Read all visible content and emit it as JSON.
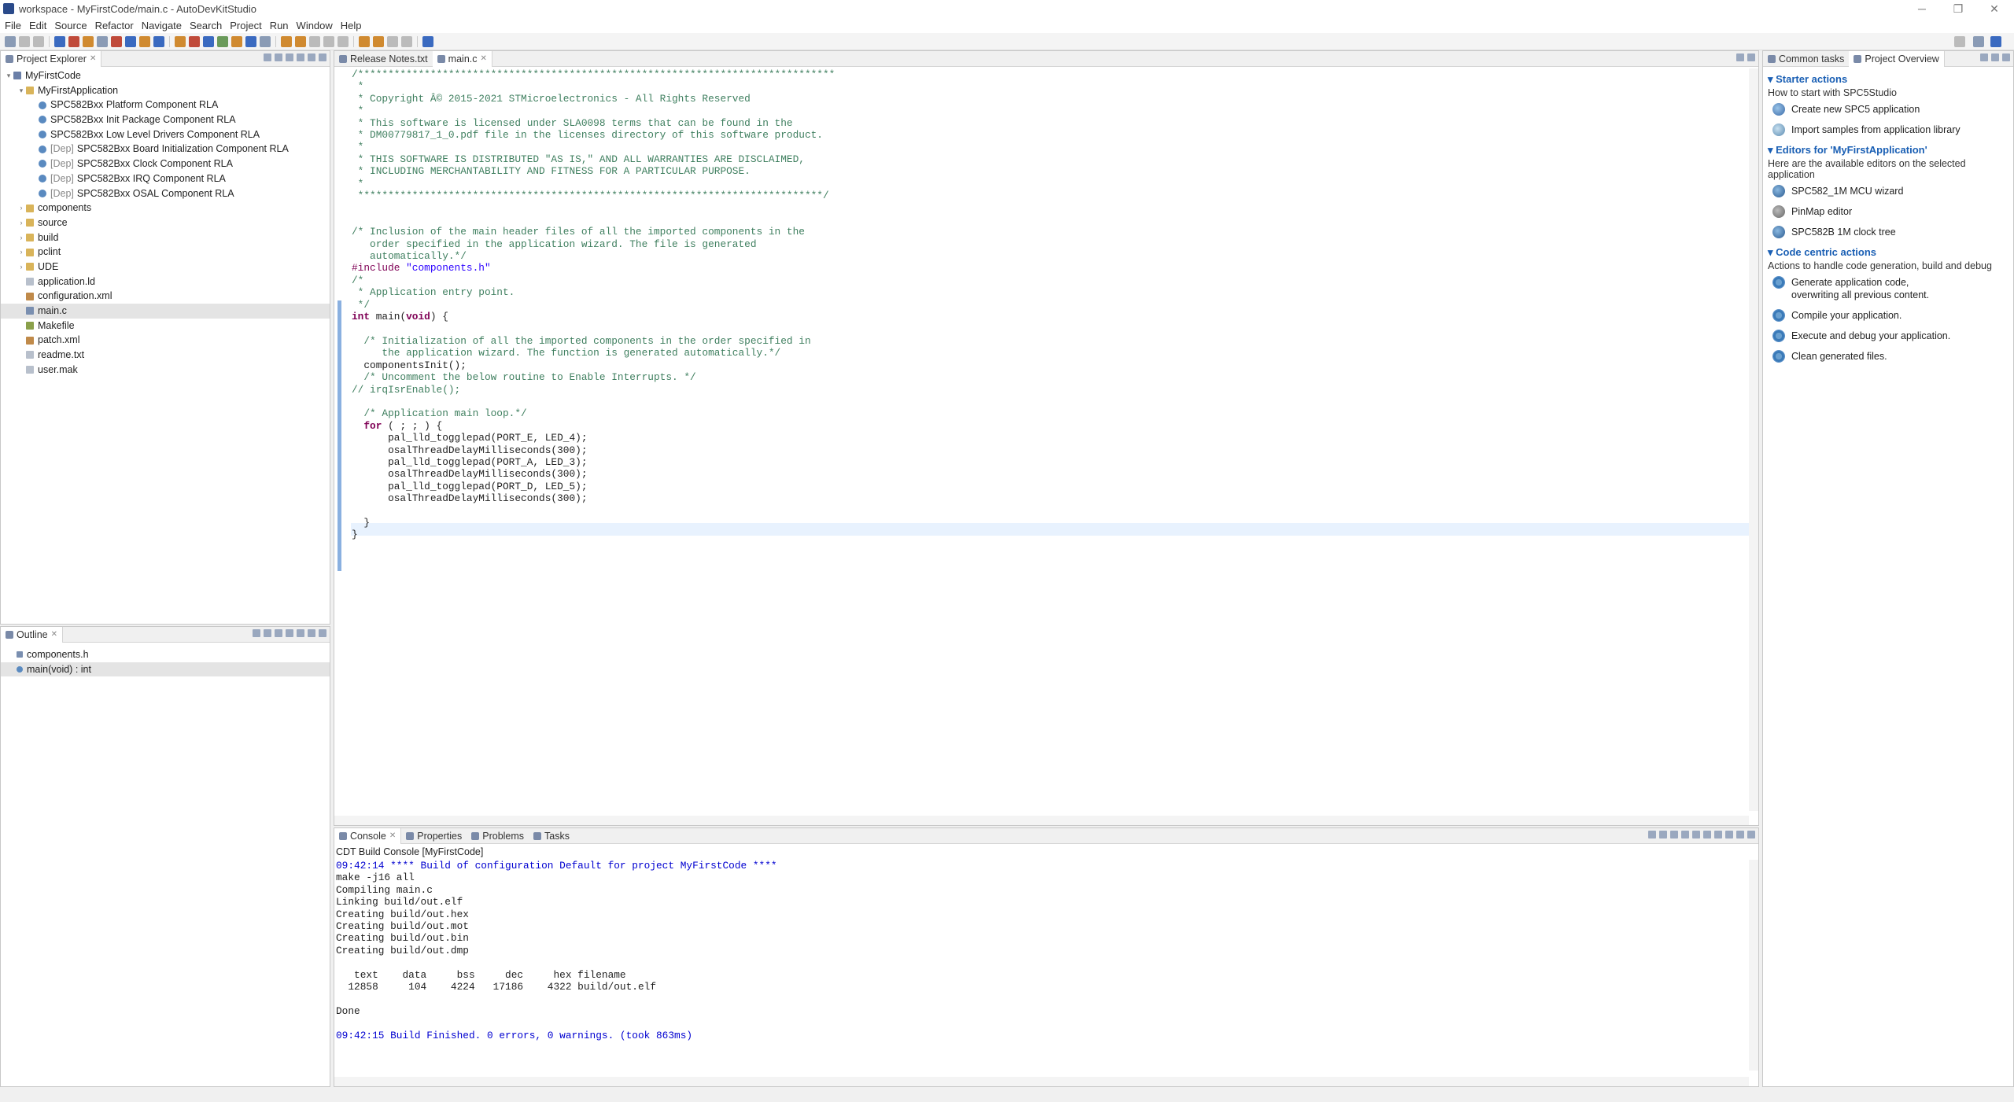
{
  "window": {
    "title": "workspace - MyFirstCode/main.c - AutoDevKitStudio",
    "controls": [
      "─",
      "❐",
      "✕"
    ]
  },
  "menu": [
    "File",
    "Edit",
    "Source",
    "Refactor",
    "Navigate",
    "Search",
    "Project",
    "Run",
    "Window",
    "Help"
  ],
  "project_explorer": {
    "title": "Project Explorer",
    "tree": [
      {
        "label": "MyFirstCode",
        "depth": 0,
        "icon": "project-icon",
        "twisty": "▾"
      },
      {
        "label": "MyFirstApplication",
        "depth": 1,
        "icon": "folder-icon",
        "twisty": "▾"
      },
      {
        "label": "SPC582Bxx Platform Component RLA",
        "depth": 2,
        "icon": "component-icon"
      },
      {
        "label": "SPC582Bxx Init Package Component RLA",
        "depth": 2,
        "icon": "component-icon"
      },
      {
        "label": "SPC582Bxx Low Level Drivers Component RLA",
        "depth": 2,
        "icon": "component-icon"
      },
      {
        "label": "SPC582Bxx Board Initialization Component RLA",
        "depth": 2,
        "icon": "component-icon",
        "prefix": "[Dep]"
      },
      {
        "label": "SPC582Bxx Clock Component RLA",
        "depth": 2,
        "icon": "component-icon",
        "prefix": "[Dep]"
      },
      {
        "label": "SPC582Bxx IRQ Component RLA",
        "depth": 2,
        "icon": "component-icon",
        "prefix": "[Dep]"
      },
      {
        "label": "SPC582Bxx OSAL Component RLA",
        "depth": 2,
        "icon": "component-icon",
        "prefix": "[Dep]"
      },
      {
        "label": "components",
        "depth": 1,
        "icon": "folder-icon",
        "twisty": "›"
      },
      {
        "label": "source",
        "depth": 1,
        "icon": "folder-icon",
        "twisty": "›"
      },
      {
        "label": "build",
        "depth": 1,
        "icon": "folder-icon",
        "twisty": "›"
      },
      {
        "label": "pclint",
        "depth": 1,
        "icon": "folder-icon",
        "twisty": "›"
      },
      {
        "label": "UDE",
        "depth": 1,
        "icon": "folder-icon",
        "twisty": "›"
      },
      {
        "label": "application.ld",
        "depth": 1,
        "icon": "file-icon"
      },
      {
        "label": "configuration.xml",
        "depth": 1,
        "icon": "xml-file-icon"
      },
      {
        "label": "main.c",
        "depth": 1,
        "icon": "c-file-icon",
        "selected": true
      },
      {
        "label": "Makefile",
        "depth": 1,
        "icon": "makefile-icon"
      },
      {
        "label": "patch.xml",
        "depth": 1,
        "icon": "xml-file-icon"
      },
      {
        "label": "readme.txt",
        "depth": 1,
        "icon": "file-icon"
      },
      {
        "label": "user.mak",
        "depth": 1,
        "icon": "file-icon"
      }
    ]
  },
  "outline": {
    "title": "Outline",
    "items": [
      {
        "label": "components.h",
        "icon": "include-icon"
      },
      {
        "label": "main(void) : int",
        "icon": "function-icon",
        "selected": true
      }
    ]
  },
  "editor": {
    "tabs": [
      {
        "label": "Release Notes.txt",
        "active": false
      },
      {
        "label": "main.c",
        "active": true
      }
    ],
    "lines": [
      [
        [
          "cm",
          "/*******************************************************************************"
        ]
      ],
      [
        [
          "cm",
          " *"
        ]
      ],
      [
        [
          "cm",
          " * Copyright Â© 2015-2021 STMicroelectronics - All Rights Reserved"
        ]
      ],
      [
        [
          "cm",
          " *"
        ]
      ],
      [
        [
          "cm",
          " * This software is licensed under SLA0098 terms that can be found in the"
        ]
      ],
      [
        [
          "cm",
          " * DM00779817_1_0.pdf file in the licenses directory of this software product."
        ]
      ],
      [
        [
          "cm",
          " *"
        ]
      ],
      [
        [
          "cm",
          " * THIS SOFTWARE IS DISTRIBUTED \"AS IS,\" AND ALL WARRANTIES ARE DISCLAIMED,"
        ]
      ],
      [
        [
          "cm",
          " * INCLUDING MERCHANTABILITY AND FITNESS FOR A PARTICULAR PURPOSE."
        ]
      ],
      [
        [
          "cm",
          " *"
        ]
      ],
      [
        [
          "cm",
          " *****************************************************************************/"
        ]
      ],
      [
        [
          "pl",
          ""
        ]
      ],
      [
        [
          "pl",
          ""
        ]
      ],
      [
        [
          "cm",
          "/* Inclusion of the main header files of all the imported components in the"
        ]
      ],
      [
        [
          "cm",
          "   order specified in the application wizard. The file is generated"
        ]
      ],
      [
        [
          "cm",
          "   automatically.*/"
        ]
      ],
      [
        [
          "pp",
          "#include "
        ],
        [
          "str",
          "\"components.h\""
        ]
      ],
      [
        [
          "cm",
          "/*"
        ]
      ],
      [
        [
          "cm",
          " * Application entry point."
        ]
      ],
      [
        [
          "cm",
          " */"
        ]
      ],
      [
        [
          "kw",
          "int"
        ],
        [
          "pl",
          " main("
        ],
        [
          "kw",
          "void"
        ],
        [
          "pl",
          ") {"
        ]
      ],
      [
        [
          "pl",
          ""
        ]
      ],
      [
        [
          "pl",
          "  "
        ],
        [
          "cm",
          "/* Initialization of all the imported components in the order specified in"
        ]
      ],
      [
        [
          "cm",
          "     the application wizard. The function is generated automatically.*/"
        ]
      ],
      [
        [
          "pl",
          "  componentsInit();"
        ]
      ],
      [
        [
          "pl",
          "  "
        ],
        [
          "cm",
          "/* Uncomment the below routine to Enable Interrupts. */"
        ]
      ],
      [
        [
          "cm",
          "// irqIsrEnable();"
        ]
      ],
      [
        [
          "pl",
          ""
        ]
      ],
      [
        [
          "pl",
          "  "
        ],
        [
          "cm",
          "/* Application main loop.*/"
        ]
      ],
      [
        [
          "pl",
          "  "
        ],
        [
          "kw",
          "for"
        ],
        [
          "pl",
          " ( ; ; ) {"
        ]
      ],
      [
        [
          "pl",
          "      pal_lld_togglepad(PORT_E, LED_4);"
        ]
      ],
      [
        [
          "pl",
          "      osalThreadDelayMilliseconds(300);"
        ]
      ],
      [
        [
          "pl",
          "      pal_lld_togglepad(PORT_A, LED_3);"
        ]
      ],
      [
        [
          "pl",
          "      osalThreadDelayMilliseconds(300);"
        ]
      ],
      [
        [
          "pl",
          "      pal_lld_togglepad(PORT_D, LED_5);"
        ]
      ],
      [
        [
          "pl",
          "      osalThreadDelayMilliseconds(300);"
        ]
      ],
      [
        [
          "pl",
          ""
        ]
      ],
      [
        [
          "pl",
          "  }"
        ]
      ],
      [
        [
          "pl",
          "}"
        ]
      ]
    ]
  },
  "bottom": {
    "tabs": [
      "Console",
      "Properties",
      "Problems",
      "Tasks"
    ],
    "console_title": "CDT Build Console [MyFirstCode]",
    "lines": [
      {
        "text": "09:42:14 **** Build of configuration Default for project MyFirstCode ****",
        "color": "blue"
      },
      {
        "text": "make -j16 all"
      },
      {
        "text": "Compiling main.c"
      },
      {
        "text": "Linking build/out.elf"
      },
      {
        "text": "Creating build/out.hex"
      },
      {
        "text": "Creating build/out.mot"
      },
      {
        "text": "Creating build/out.bin"
      },
      {
        "text": "Creating build/out.dmp"
      },
      {
        "text": ""
      },
      {
        "text": "   text    data     bss     dec     hex filename"
      },
      {
        "text": "  12858     104    4224   17186    4322 build/out.elf"
      },
      {
        "text": ""
      },
      {
        "text": "Done"
      },
      {
        "text": ""
      },
      {
        "text": "09:42:15 Build Finished. 0 errors, 0 warnings. (took 863ms)",
        "color": "blue"
      }
    ]
  },
  "overview": {
    "tabs": [
      "Common tasks",
      "Project Overview"
    ],
    "sections": [
      {
        "title": "Starter actions",
        "subtitle": "How to start with SPC5Studio",
        "items": [
          {
            "label": "Create new SPC5 application",
            "icon": "new-application-icon",
            "style": "c1"
          },
          {
            "label": "Import samples from application library",
            "icon": "import-samples-icon",
            "style": "c2"
          }
        ]
      },
      {
        "title": "Editors for 'MyFirstApplication'",
        "subtitle": "Here are the available editors on the selected application",
        "items": [
          {
            "label": "SPC582_1M MCU wizard",
            "icon": "mcu-wizard-icon",
            "style": "c3"
          },
          {
            "label": "PinMap editor",
            "icon": "pinmap-editor-icon",
            "style": "c4"
          },
          {
            "label": "SPC582B 1M clock tree",
            "icon": "clock-tree-icon",
            "style": "c3"
          }
        ]
      },
      {
        "title": "Code centric actions",
        "subtitle": "Actions to handle code generation, build and debug",
        "items": [
          {
            "label": "Generate application code,\noverwriting all previous content.",
            "icon": "generate-code-icon",
            "style": "gear"
          },
          {
            "label": "Compile your application.",
            "icon": "compile-icon",
            "style": "gear"
          },
          {
            "label": "Execute and debug your application.",
            "icon": "debug-icon",
            "style": "gear"
          },
          {
            "label": "Clean generated files.",
            "icon": "clean-icon",
            "style": "gear"
          }
        ]
      }
    ]
  }
}
